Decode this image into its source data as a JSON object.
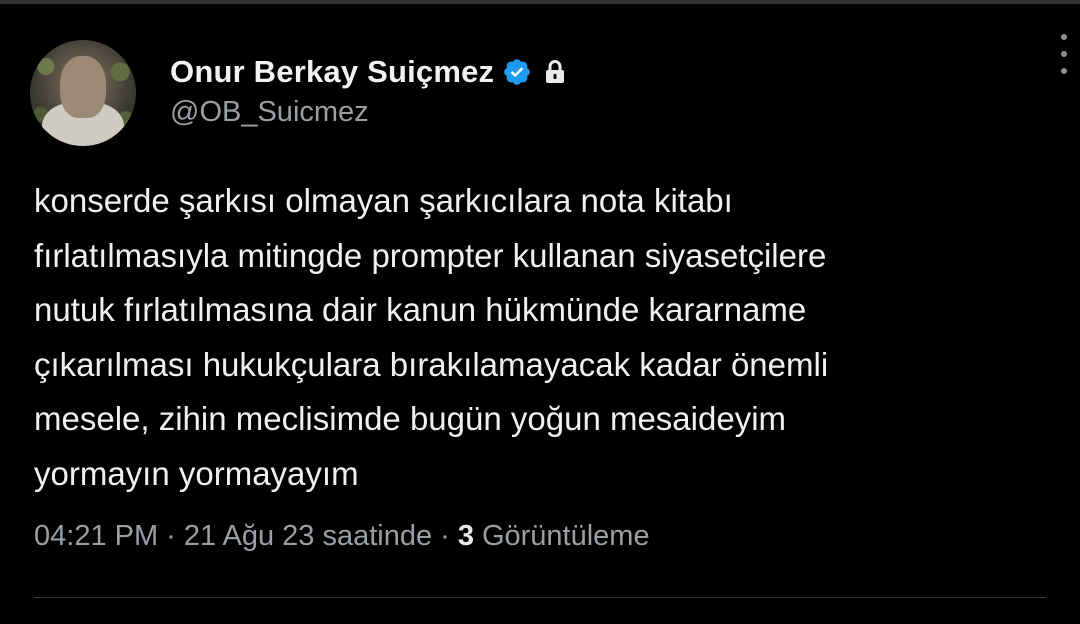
{
  "author": {
    "display_name": "Onur Berkay Suiçmez",
    "handle": "@OB_Suicmez",
    "verified_icon": "verified-badge-icon",
    "protected_icon": "lock-icon"
  },
  "tweet": {
    "lines": [
      "konserde şarkısı olmayan şarkıcılara nota kitabı",
      "fırlatılmasıyla mitingde prompter kullanan siyasetçilere",
      "nutuk fırlatılmasına dair kanun hükmünde kararname",
      "çıkarılması hukukçulara bırakılamayacak kadar önemli",
      "mesele, zihin meclisimde bugün yoğun mesaideyim",
      "yormayın yormayayım"
    ]
  },
  "meta": {
    "time": "04:21 PM",
    "separator": "·",
    "date": "21 Ağu 23 saatinde",
    "views_count": "3",
    "views_label": "Görüntüleme"
  },
  "colors": {
    "background": "#000000",
    "text": "#e7e9ea",
    "secondary": "#9a9fa4",
    "verified": "#1d9bf0",
    "divider": "#2f3336"
  }
}
